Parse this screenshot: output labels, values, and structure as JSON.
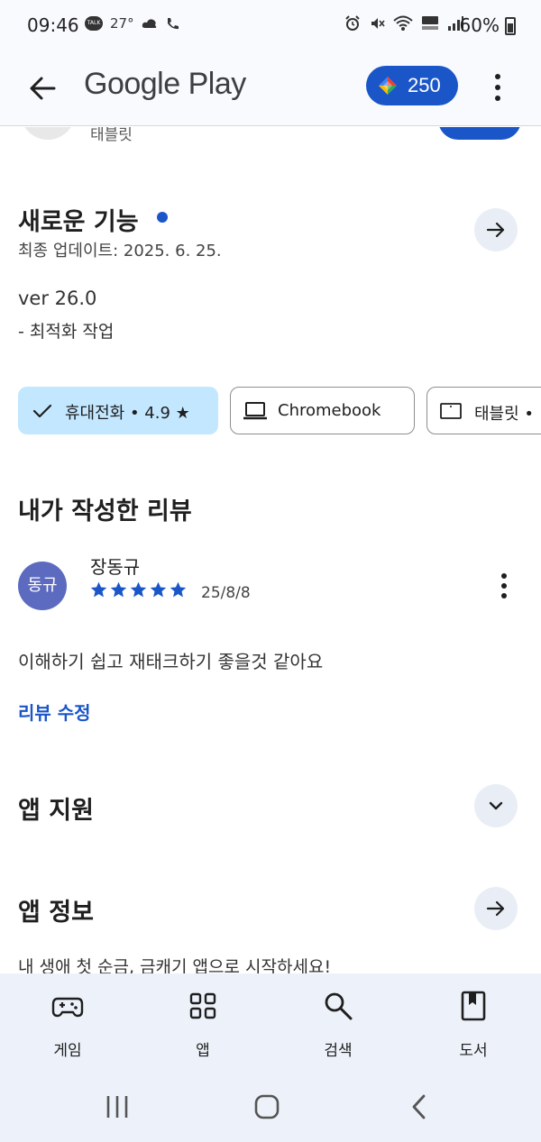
{
  "status_bar": {
    "time": "09:46",
    "notification_icons": [
      "talk-icon",
      "weather-icon",
      "cloud-icon",
      "call-icon"
    ],
    "temperature": "27°",
    "system_icons": [
      "alarm-icon",
      "mute-icon",
      "wifi-icon",
      "hd-voice-icon",
      "signal-icon"
    ],
    "battery": "60%",
    "talk_label": "TALK"
  },
  "app_bar": {
    "title": "Google Play",
    "points": "250"
  },
  "partial_row": {
    "subtitle": "태블릿"
  },
  "whats_new": {
    "title": "새로운 기능",
    "updated": "최종 업데이트: 2025. 6. 25.",
    "version": "ver 26.0",
    "note": "- 최적화 작업"
  },
  "device_chips": [
    {
      "label": "휴대전화 • 4.9 ★",
      "selected": true
    },
    {
      "label": "Chromebook",
      "selected": false
    },
    {
      "label": "태블릿 •",
      "selected": false
    }
  ],
  "my_review": {
    "heading": "내가 작성한 리뷰",
    "avatar_text": "동규",
    "author": "장동규",
    "rating": 5,
    "date": "25/8/8",
    "body": "이해하기 쉽고 재태크하기 좋을것 같아요",
    "edit_label": "리뷰 수정"
  },
  "app_support": {
    "title": "앱 지원"
  },
  "app_info": {
    "title": "앱 정보",
    "description": "내 생애 첫 순금, 금캐기 앱으로 시작하세요!"
  },
  "bottom_nav": [
    {
      "label": "게임",
      "icon": "gamepad-icon"
    },
    {
      "label": "앱",
      "icon": "apps-grid-icon"
    },
    {
      "label": "검색",
      "icon": "search-icon"
    },
    {
      "label": "도서",
      "icon": "book-icon"
    }
  ],
  "colors": {
    "accent": "#1a56c8",
    "chip_selected": "#c2e7ff",
    "nav_background": "#edf2fa"
  }
}
